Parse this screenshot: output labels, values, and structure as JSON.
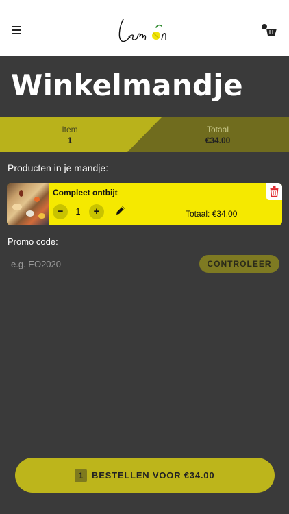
{
  "header": {
    "menu_icon": "hamburger-icon",
    "brand": "Lemon",
    "cart_icon": "basket-icon"
  },
  "page": {
    "title": "Winkelmandje"
  },
  "summary": {
    "item_label": "Item",
    "item_value": "1",
    "total_label": "Totaal",
    "total_value": "€34.00"
  },
  "cart": {
    "section_label": "Producten in je mandje:",
    "items": [
      {
        "name": "Compleet ontbijt",
        "quantity": "1",
        "total_text": "Totaal: €34.00",
        "minus_label": "−",
        "plus_label": "+",
        "edit_icon": "pencil-icon",
        "delete_icon": "trash-icon"
      }
    ]
  },
  "promo": {
    "label": "Promo code:",
    "placeholder": "e.g. EO2020",
    "check_label": "CONTROLEER"
  },
  "order": {
    "count": "1",
    "label": "BESTELLEN VOOR €34.00"
  },
  "colors": {
    "accent": "#bdb51b",
    "card": "#f5e900",
    "background": "#3a3a3a",
    "delete": "#e0282e"
  }
}
